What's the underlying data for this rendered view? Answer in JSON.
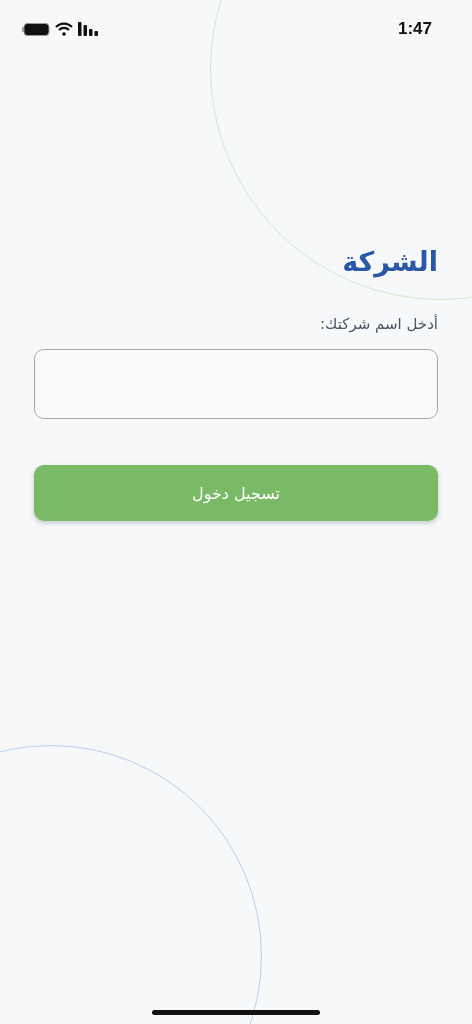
{
  "status_bar": {
    "time": "1:47"
  },
  "title": "الشركة",
  "company_field": {
    "label": "أدخل اسم شركتك:"
  },
  "login_button": {
    "label": "تسجيل دخول"
  }
}
